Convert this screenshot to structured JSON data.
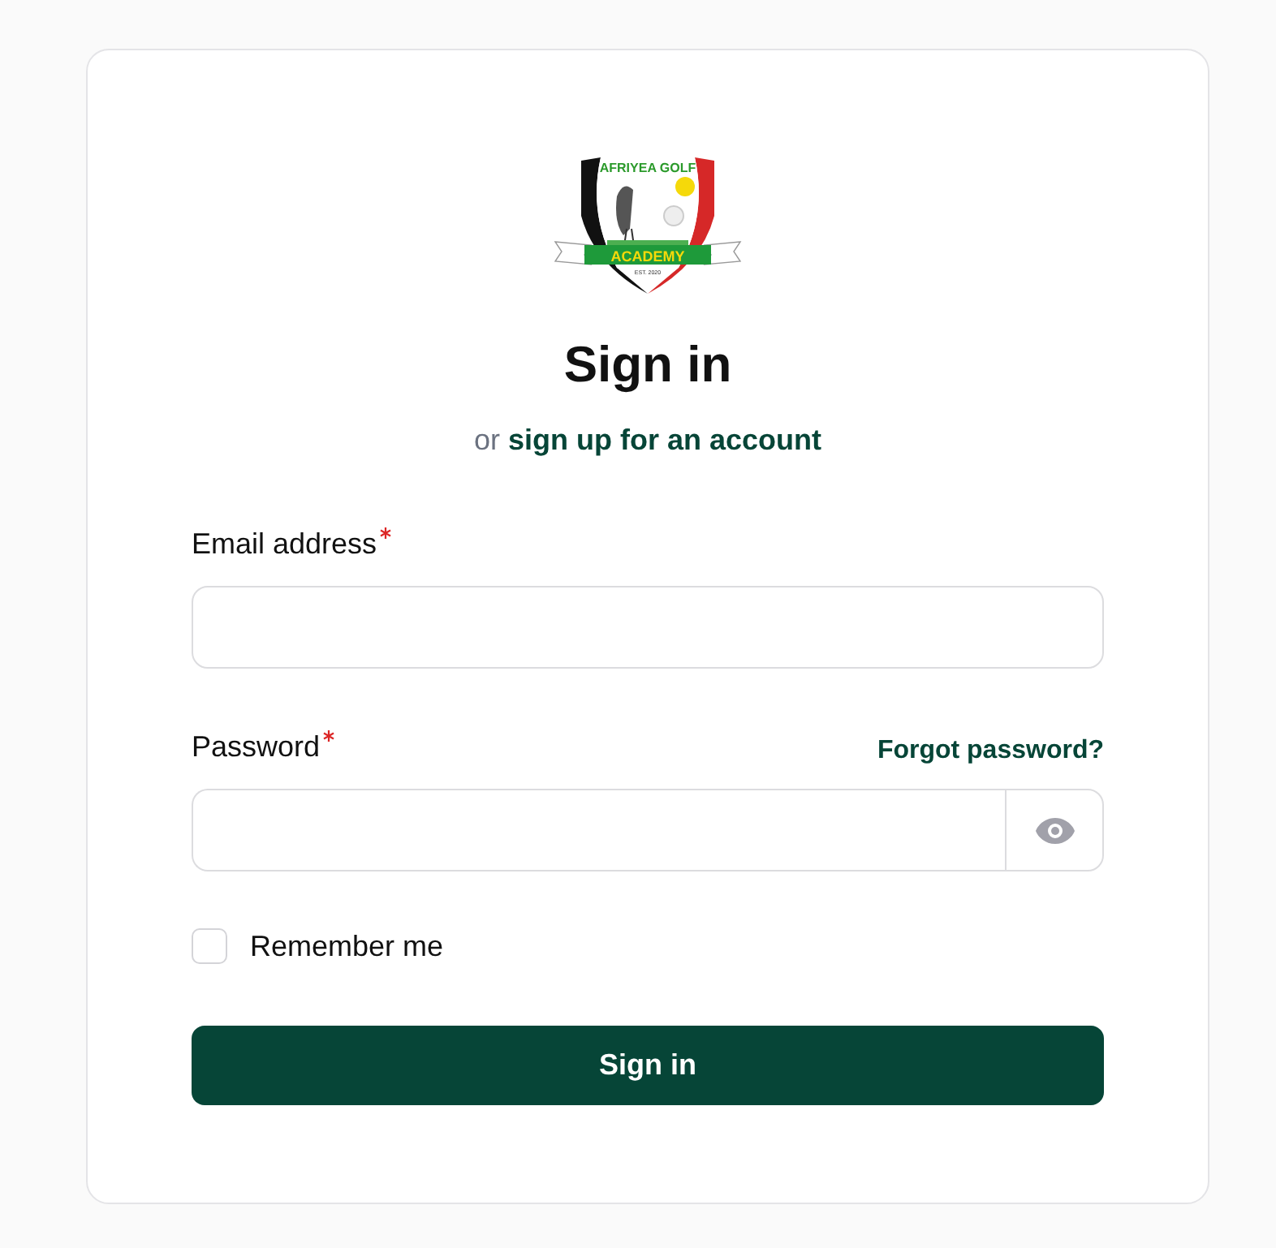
{
  "logo": {
    "top_text": "AFRIYEA GOLF",
    "banner_text": "ACADEMY",
    "est_text": "EST. 2020"
  },
  "heading": "Sign in",
  "subheading": {
    "prefix": "or",
    "link": "sign up for an account"
  },
  "fields": [
    {
      "kind": "email",
      "label": "Email address",
      "required": true
    },
    {
      "kind": "password",
      "label": "Password",
      "required": true,
      "link": "Forgot password?"
    }
  ],
  "remember": {
    "label": "Remember me",
    "checked": false
  },
  "submit": "Sign in"
}
